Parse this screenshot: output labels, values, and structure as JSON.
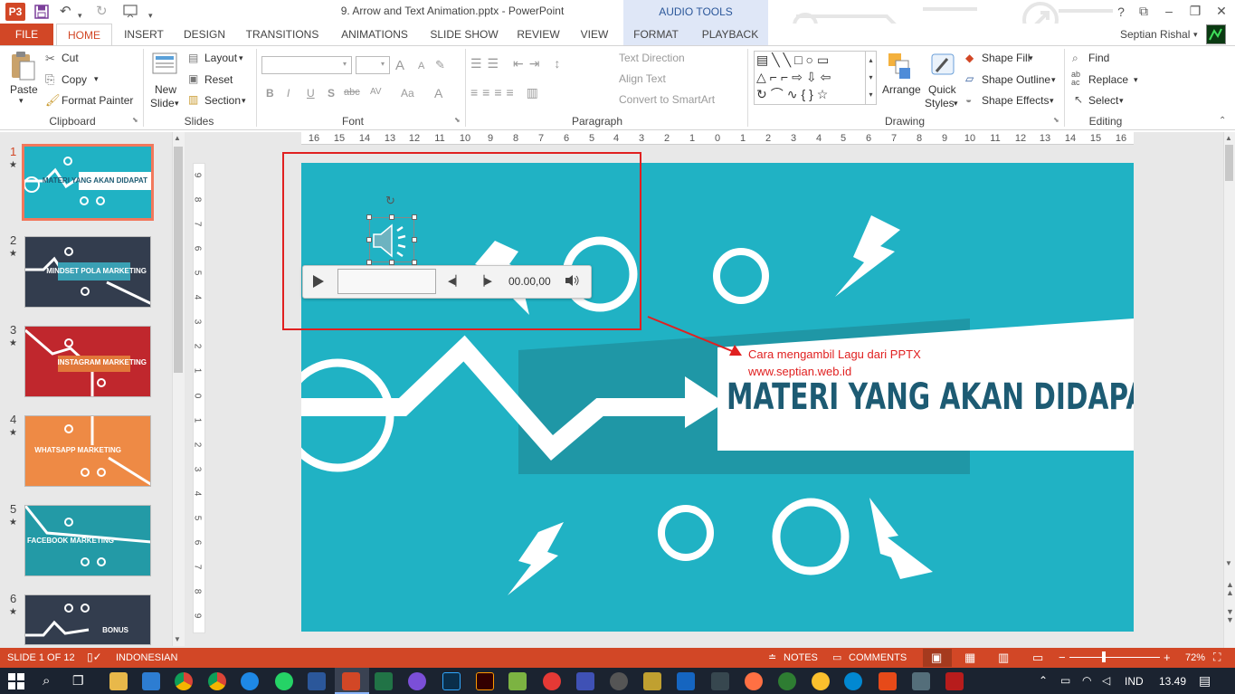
{
  "window": {
    "title": "9. Arrow and Text Animation.pptx - PowerPoint",
    "context_group": "AUDIO TOOLS",
    "help": "?",
    "app_icon": "P3",
    "user": "Septian Rishal"
  },
  "tabs": [
    {
      "label": "FILE"
    },
    {
      "label": "HOME"
    },
    {
      "label": "INSERT"
    },
    {
      "label": "DESIGN"
    },
    {
      "label": "TRANSITIONS"
    },
    {
      "label": "ANIMATIONS"
    },
    {
      "label": "SLIDE SHOW"
    },
    {
      "label": "REVIEW"
    },
    {
      "label": "VIEW"
    },
    {
      "label": "FORMAT"
    },
    {
      "label": "PLAYBACK"
    }
  ],
  "ribbon": {
    "clipboard": {
      "label": "Clipboard",
      "paste": "Paste",
      "cut": "Cut",
      "copy": "Copy",
      "format_painter": "Format Painter"
    },
    "slides": {
      "label": "Slides",
      "new_slide": "New",
      "new_slide2": "Slide",
      "layout": "Layout",
      "reset": "Reset",
      "section": "Section"
    },
    "font": {
      "label": "Font",
      "bold": "B",
      "italic": "I",
      "underline": "U",
      "shadow": "S",
      "strike": "abc",
      "spacing": "AV",
      "case": "Aa",
      "color": "A",
      "grow": "A",
      "shrink": "A"
    },
    "paragraph": {
      "label": "Paragraph",
      "text_direction": "Text Direction",
      "align_text": "Align Text",
      "smartart": "Convert to SmartArt"
    },
    "drawing": {
      "label": "Drawing",
      "arrange": "Arrange",
      "quick": "Quick",
      "styles": "Styles",
      "shape_fill": "Shape Fill",
      "shape_outline": "Shape Outline",
      "shape_effects": "Shape Effects"
    },
    "editing": {
      "label": "Editing",
      "find": "Find",
      "replace": "Replace",
      "select": "Select",
      "replace_ab": "ab",
      "replace_ac": "ac"
    }
  },
  "ruler": {
    "h_ticks": [
      "16",
      "15",
      "14",
      "13",
      "12",
      "11",
      "10",
      "9",
      "8",
      "7",
      "6",
      "5",
      "4",
      "3",
      "2",
      "1",
      "0",
      "1",
      "2",
      "3",
      "4",
      "5",
      "6",
      "7",
      "8",
      "9",
      "10",
      "11",
      "12",
      "13",
      "14",
      "15",
      "16"
    ],
    "v_ticks": [
      "9",
      "8",
      "7",
      "6",
      "5",
      "4",
      "3",
      "2",
      "1",
      "0",
      "1",
      "2",
      "3",
      "4",
      "5",
      "6",
      "7",
      "8",
      "9"
    ]
  },
  "thumbnails": [
    {
      "num": "1",
      "title": "MATERI YANG AKAN DIDAPAT",
      "bg": "#20b2c4"
    },
    {
      "num": "2",
      "title": "MINDSET POLA MARKETING",
      "bg": "#333d4e"
    },
    {
      "num": "3",
      "title": "INSTAGRAM MARKETING",
      "bg": "#c0272d"
    },
    {
      "num": "4",
      "title": "WHATSAPP MARKETING",
      "bg": "#ee8a45"
    },
    {
      "num": "5",
      "title": "FACEBOOK MARKETING",
      "bg": "#239aa6"
    },
    {
      "num": "6",
      "title": "BONUS",
      "bg": "#333d4e"
    }
  ],
  "slide": {
    "title": "MATERI YANG AKAN DIDAPAT",
    "annotation_line1": "Cara mengambil Lagu dari PPTX",
    "annotation_line2": "www.septian.web.id",
    "bg": "#20b2c4",
    "title_color": "#1d5b73"
  },
  "player": {
    "time": "00.00,00"
  },
  "status": {
    "slide": "SLIDE 1 OF 12",
    "language": "INDONESIAN",
    "notes": "NOTES",
    "comments": "COMMENTS",
    "zoom": "72%",
    "zoom_minus": "−",
    "zoom_plus": "+"
  },
  "taskbar": {
    "lang": "IND",
    "time": "13.49"
  },
  "colors": {
    "accent": "#d24726",
    "annotation": "#e02020"
  }
}
